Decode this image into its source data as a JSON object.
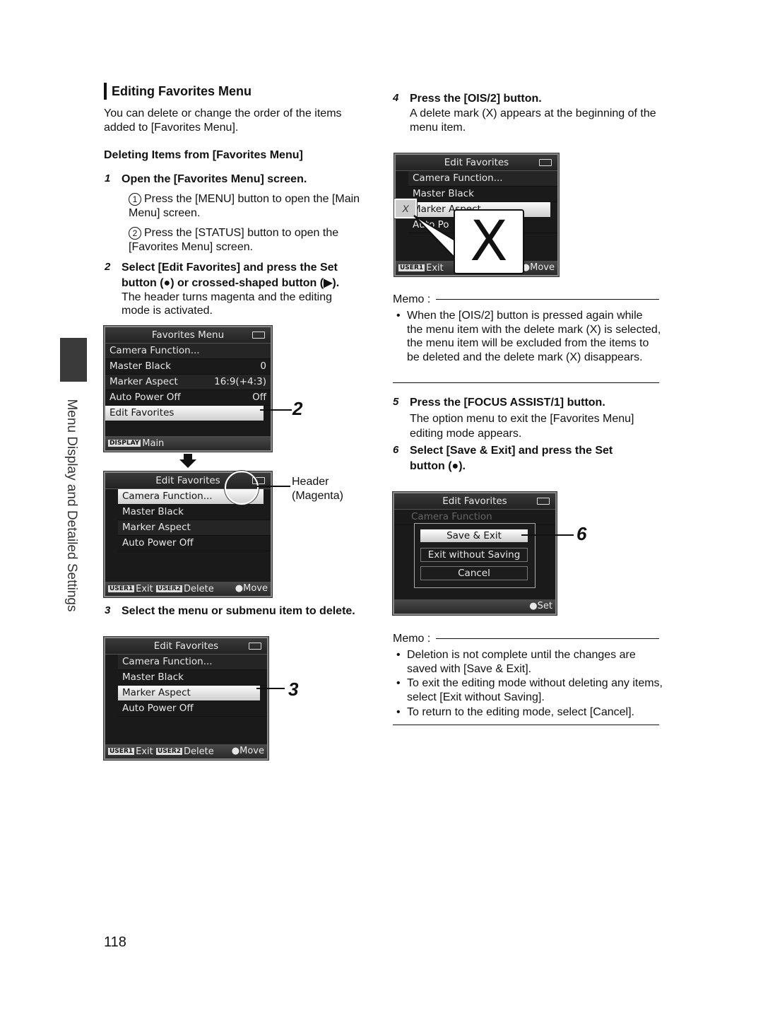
{
  "side_tab": "Menu Display and Detailed Settings",
  "page_number": "118",
  "left": {
    "title": "Editing Favorites Menu",
    "intro": "You can delete or change the order of the items added to [Favorites Menu].",
    "subtitle": "Deleting Items from [Favorites Menu]",
    "step1": {
      "num": "1",
      "title": "Open the [Favorites Menu] screen.",
      "sub": [
        {
          "mark": "1",
          "text": "Press the [MENU] button to open the [Main Menu] screen."
        },
        {
          "mark": "2",
          "text": "Press the [STATUS] button to open the [Favorites Menu] screen."
        }
      ]
    },
    "step2": {
      "num": "2",
      "title_a": "Select [Edit Favorites] and press the Set",
      "title_b": "button (●) or crossed-shaped button (▶).",
      "body": "The header turns magenta and the editing mode is activated."
    },
    "step3": {
      "num": "3",
      "title": "Select the menu or submenu item to delete."
    },
    "callout2": "2",
    "callout3": "3",
    "header_label": "Header",
    "header_label2": "(Magenta)"
  },
  "screens": {
    "fav": {
      "title": "Favorites Menu",
      "rows": [
        [
          "Camera Function...",
          ""
        ],
        [
          "Master Black",
          "0"
        ],
        [
          "Marker Aspect",
          "16:9(+4:3)"
        ],
        [
          "Auto Power Off",
          "Off"
        ],
        [
          "Edit Favorites",
          ""
        ]
      ],
      "footer_key": "DISPLAY",
      "footer_label": "Main"
    },
    "edit": {
      "title": "Edit Favorites",
      "rows": [
        "Camera Function...",
        "Master Black",
        "Marker Aspect",
        "Auto Power Off"
      ],
      "user1": "USER1",
      "exit": "Exit",
      "user2": "USER2",
      "delete": "Delete",
      "move": "●Move"
    },
    "del": {
      "title": "Edit Favorites",
      "rows": [
        "Camera Function...",
        "Master Black",
        "Marker Aspect",
        "Auto Po"
      ],
      "mark": "X",
      "user1": "USER1",
      "exit": "Exit",
      "move": "●Move"
    },
    "save": {
      "title": "Edit Favorites",
      "bg_row": "Camera Function",
      "options": [
        "Save & Exit",
        "Exit without Saving",
        "Cancel"
      ],
      "set": "●Set"
    }
  },
  "right": {
    "step4": {
      "num": "4",
      "title": "Press the [OIS/2] button.",
      "body": "A delete mark (X) appears at the beginning of the menu item."
    },
    "memo1": {
      "label": "Memo :",
      "items": [
        "When the [OIS/2] button is pressed again while the menu item with the delete mark (X) is selected, the menu item will be excluded from the items to be deleted and the delete mark (X) disappears."
      ]
    },
    "step5": {
      "num": "5",
      "title": "Press the [FOCUS ASSIST/1] button.",
      "body": "The option menu to exit the [Favorites Menu] editing mode appears."
    },
    "step6": {
      "num": "6",
      "title_a": "Select [Save & Exit] and press the Set",
      "title_b": "button (●)."
    },
    "callout6": "6",
    "memo2": {
      "label": "Memo :",
      "items": [
        "Deletion is not complete until the changes are saved with [Save & Exit].",
        "To exit the editing mode without deleting any items, select [Exit without Saving].",
        "To return to the editing mode, select [Cancel]."
      ]
    }
  }
}
